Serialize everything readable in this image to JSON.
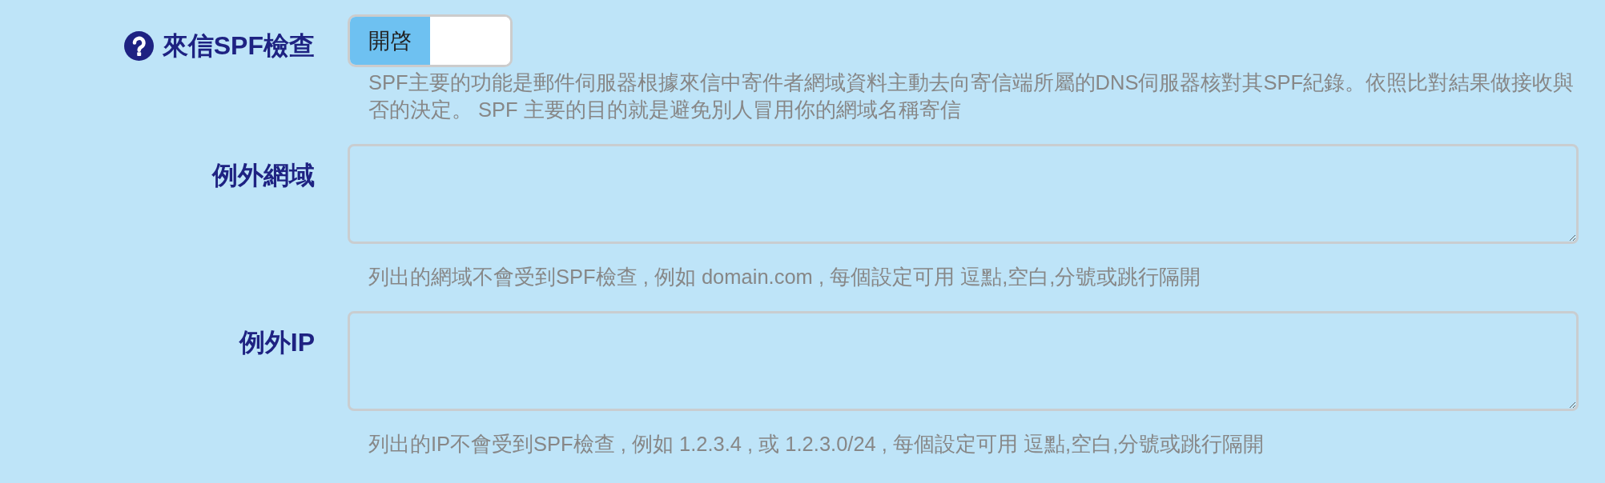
{
  "fields": [
    {
      "kind": "toggle",
      "help_icon": true,
      "label": "來信SPF檢查",
      "toggle": {
        "label": "開啓",
        "on": true
      },
      "help": "SPF主要的功能是郵件伺服器根據來信中寄件者網域資料主動去向寄信端所屬的DNS伺服器核對其SPF紀錄。依照比對結果做接收與否的決定。 SPF 主要的目的就是避免別人冒用你的網域名稱寄信"
    },
    {
      "kind": "textarea",
      "label": "例外網域",
      "help": "列出的網域不會受到SPF檢查 , 例如 domain.com , 每個設定可用 逗點,空白,分號或跳行隔開"
    },
    {
      "kind": "textarea",
      "label": "例外IP",
      "help": "列出的IP不會受到SPF檢查 , 例如 1.2.3.4 , 或 1.2.3.0/24 , 每個設定可用 逗點,空白,分號或跳行隔開"
    }
  ]
}
